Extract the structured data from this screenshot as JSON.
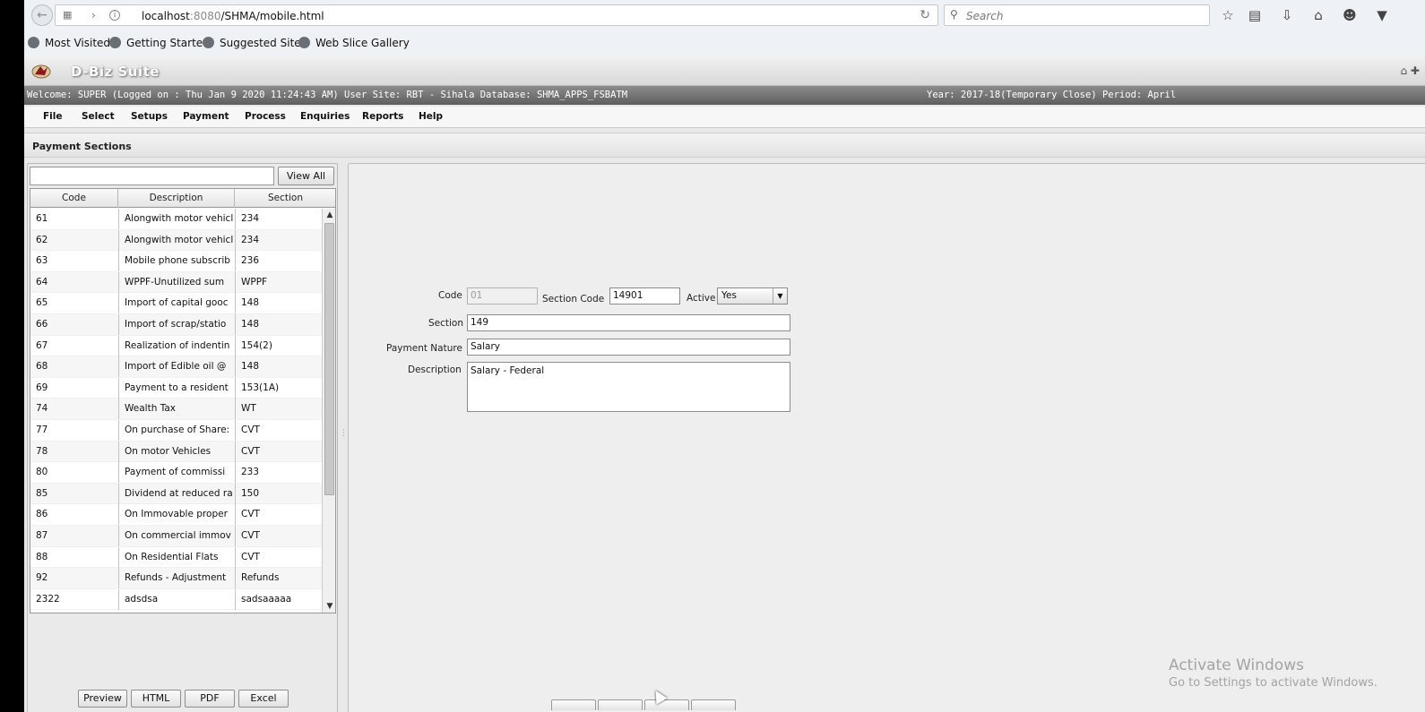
{
  "browser": {
    "url_host": "localhost",
    "url_port": ":8080",
    "url_path": "/SHMA/mobile.html",
    "search_placeholder": "Search",
    "bookmarks": [
      "Most Visited",
      "Getting Started",
      "Suggested Sites",
      "Web Slice Gallery"
    ]
  },
  "app": {
    "logo_text": "D-Biz Suite",
    "status_left": "Welcome: SUPER (Logged on : Thu Jan 9 2020 11:24:43 AM) User Site: RBT - Sihala Database: SHMA_APPS_FSBATM",
    "status_right": "Year: 2017-18(Temporary Close) Period: April",
    "menu": [
      "File",
      "Select",
      "Setups",
      "Payment",
      "Process",
      "Enquiries",
      "Reports",
      "Help"
    ],
    "page_title": "Payment Sections"
  },
  "list": {
    "filter_value": "",
    "view_all_label": "View All",
    "columns": [
      "Code",
      "Description",
      "Section"
    ],
    "rows": [
      [
        "61",
        "Alongwith motor vehicl",
        "234"
      ],
      [
        "62",
        "Alongwith motor vehicl",
        "234"
      ],
      [
        "63",
        "Mobile phone subscrib",
        "236"
      ],
      [
        "64",
        "WPPF-Unutilized sum",
        "WPPF"
      ],
      [
        "65",
        "Import of capital gooc",
        "148"
      ],
      [
        "66",
        "Import of scrap/statio",
        "148"
      ],
      [
        "67",
        "Realization of indentin",
        "154(2)"
      ],
      [
        "68",
        "Import of Edible oil @",
        "148"
      ],
      [
        "69",
        "Payment to a resident",
        "153(1A)"
      ],
      [
        "74",
        "Wealth Tax",
        "WT"
      ],
      [
        "77",
        "On purchase of Share:",
        "CVT"
      ],
      [
        "78",
        "On motor Vehicles",
        "CVT"
      ],
      [
        "80",
        "Payment of  commissi",
        "233"
      ],
      [
        "85",
        "Dividend at reduced ra",
        "150"
      ],
      [
        "86",
        "On Immovable proper",
        "CVT"
      ],
      [
        "87",
        "On commercial immov",
        "CVT"
      ],
      [
        "88",
        "On Residential Flats",
        "CVT"
      ],
      [
        "92",
        "Refunds - Adjustment",
        "Refunds"
      ],
      [
        "2322",
        "adsdsa",
        "sadsaaaaa"
      ]
    ],
    "export_buttons": [
      "Preview",
      "HTML",
      "PDF",
      "Excel"
    ]
  },
  "form": {
    "code_label": "Code",
    "code_value": "01",
    "section_code_label": "Section Code",
    "section_code_value": "14901",
    "active_label": "Active",
    "active_value": "Yes",
    "section_label": "Section",
    "section_value": "149",
    "payment_nature_label": "Payment Nature",
    "payment_nature_value": "Salary",
    "description_label": "Description",
    "description_value": "Salary - Federal"
  },
  "watermark": {
    "line1": "Activate Windows",
    "line2": "Go to Settings to activate Windows."
  }
}
